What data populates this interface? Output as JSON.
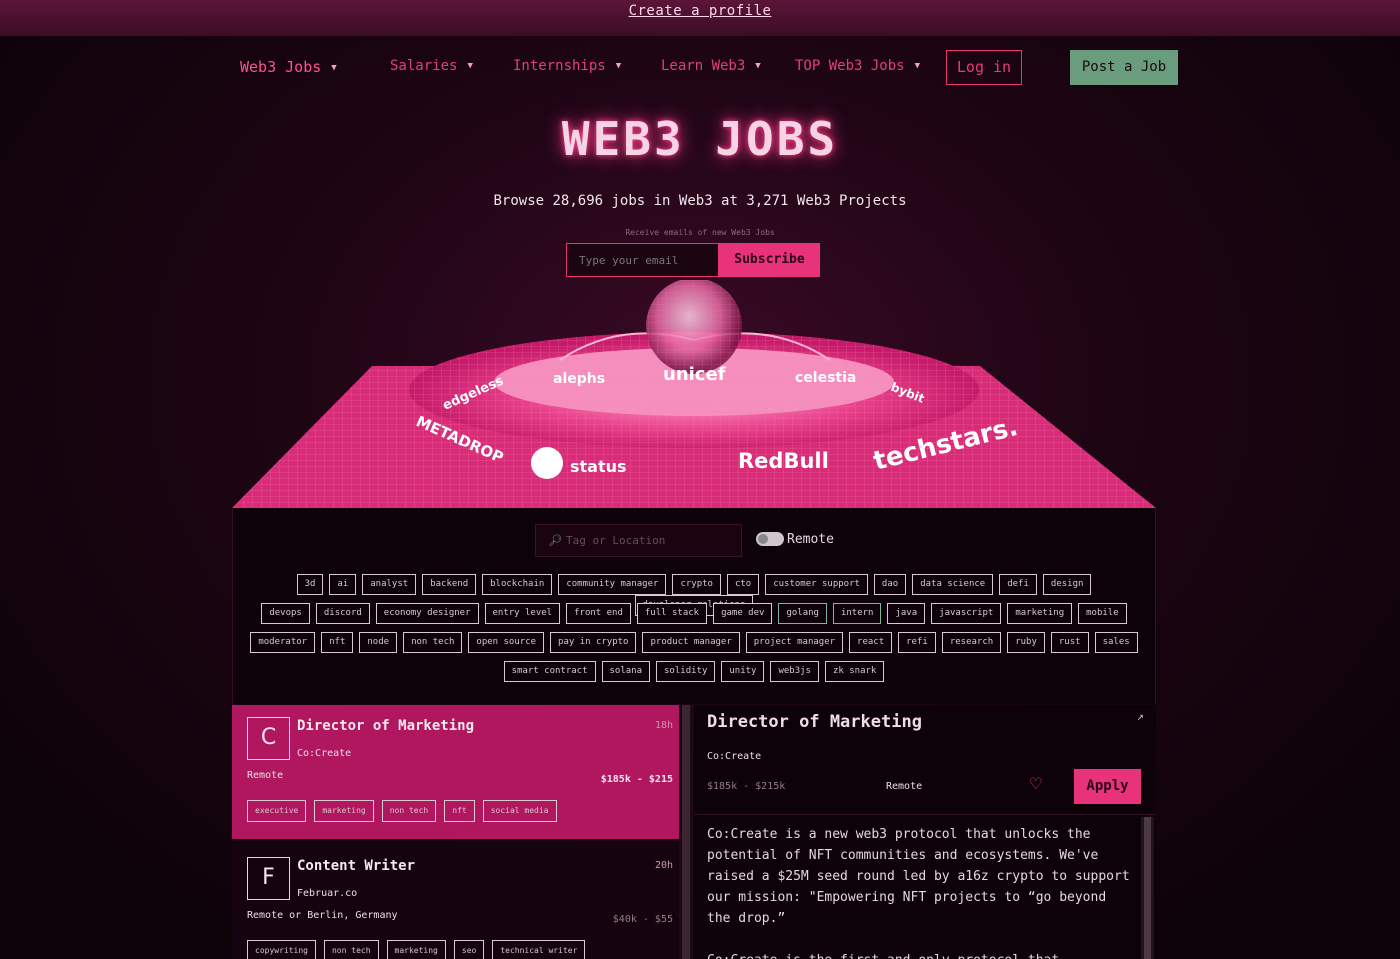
{
  "topbar": {
    "link": "Create a profile"
  },
  "nav": {
    "items": [
      {
        "label": "Web3 Jobs"
      },
      {
        "label": "Salaries"
      },
      {
        "label": "Internships"
      },
      {
        "label": "Learn Web3"
      },
      {
        "label": "TOP Web3 Jobs"
      }
    ],
    "login": "Log in",
    "post_job": "Post a Job"
  },
  "hero": {
    "title": "WEB3 JOBS",
    "subtitle": "Browse 28,696 jobs in Web3 at 3,271 Web3 Projects",
    "receive": "Receive emails of new Web3 Jobs",
    "email_placeholder": "Type your email",
    "subscribe": "Subscribe",
    "platform_logos": [
      "edgeless",
      "alephs",
      "unicef",
      "celestia",
      "bybit",
      "METADROP",
      "status",
      "RedBull",
      "techstars."
    ]
  },
  "filters": {
    "search_placeholder": "Tag or Location",
    "remote_label": "Remote",
    "tag_rows": [
      [
        "3d",
        "ai",
        "analyst",
        "backend",
        "blockchain",
        "community manager",
        "crypto",
        "cto",
        "customer support",
        "dao",
        "data science",
        "defi",
        "design",
        "developer relations"
      ],
      [
        "devops",
        "discord",
        "economy designer",
        "entry level",
        "front end",
        "full stack",
        "game dev",
        "golang",
        "intern",
        "java",
        "javascript",
        "marketing",
        "mobile"
      ],
      [
        "moderator",
        "nft",
        "node",
        "non tech",
        "open source",
        "pay in crypto",
        "product manager",
        "project manager",
        "react",
        "refi",
        "research",
        "ruby",
        "rust",
        "sales"
      ],
      [
        "smart contract",
        "solana",
        "solidity",
        "unity",
        "web3js",
        "zk snark"
      ]
    ]
  },
  "jobs": [
    {
      "logo_letter": "C",
      "title": "Director of Marketing",
      "company": "Co:Create",
      "age": "18h",
      "location": "Remote",
      "salary": "$185k - $215",
      "tags": [
        "executive",
        "marketing",
        "non tech",
        "nft",
        "social media"
      ]
    },
    {
      "logo_letter": "F",
      "title": "Content Writer",
      "company": "Februar.co",
      "age": "20h",
      "location": "Remote or Berlin, Germany",
      "salary": "$40k - $55",
      "tags": [
        "copywriting",
        "non tech",
        "marketing",
        "seo",
        "technical writer"
      ]
    }
  ],
  "detail": {
    "title": "Director of Marketing",
    "company": "Co:Create",
    "salary": "$185k - $215k",
    "location": "Remote",
    "apply": "Apply",
    "body": [
      "Co:Create is a new web3 protocol that unlocks the potential of NFT communities and ecosystems. We've raised a $25M seed round led by a16z crypto to support our mission: \"Empowering NFT projects to “go beyond the drop.”",
      "Co:Create is the first and only protocol that"
    ]
  },
  "colors": {
    "accent_pink": "#e8337a",
    "active_card": "#b0175f",
    "post_button": "#6a9d7e",
    "background": "#0c0208"
  },
  "icons": [
    "caret-down-icon",
    "search-icon",
    "toggle-icon",
    "external-link-icon",
    "heart-icon"
  ]
}
